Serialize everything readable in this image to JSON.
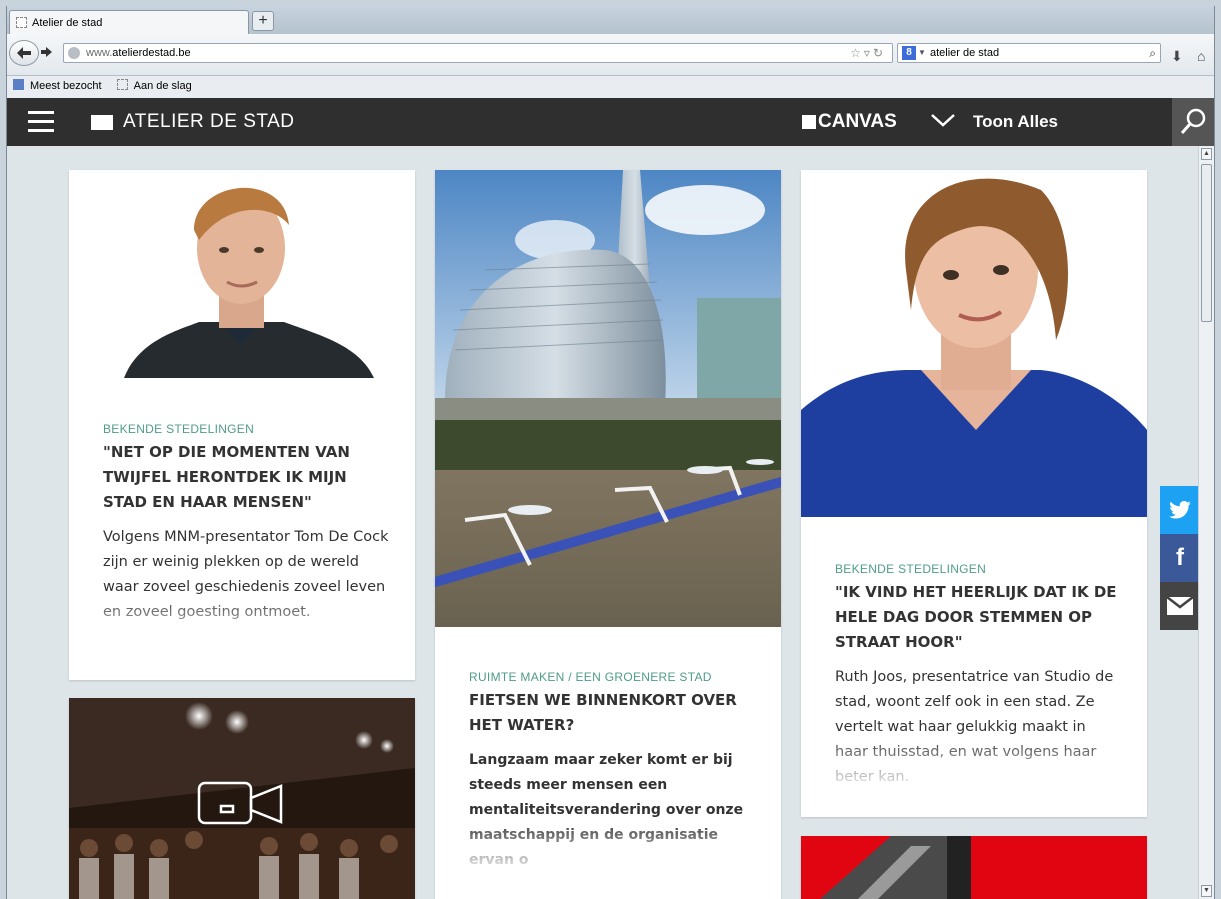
{
  "browser": {
    "tab_title": "Atelier de stad",
    "new_tab": "+",
    "url_prefix": "www.",
    "url_domain": "atelierdestad.be",
    "search_engine_badge": "8",
    "search_value": "atelier de stad",
    "bookmarks": [
      "Meest bezocht",
      "Aan de slag"
    ]
  },
  "site": {
    "brand": "ATELIER DE STAD",
    "canvas": "CANVAS",
    "toon_alles": "Toon Alles"
  },
  "cards": [
    {
      "category": "BEKENDE STEDELINGEN",
      "title": "\"NET OP DIE MOMENTEN VAN TWIJFEL HERONTDEK IK MIJN STAD EN HAAR MENSEN\"",
      "teaser": "Volgens MNM-presentator Tom De Cock zijn er weinig plekken op de wereld waar zoveel geschiedenis zoveel leven en zoveel goesting ontmoet."
    },
    {
      "category": "RUIMTE MAKEN / EEN GROENERE STAD",
      "title": "FIETSEN WE BINNENKORT OVER HET WATER?",
      "teaser": "Langzaam maar zeker komt er bij steeds meer mensen een mentaliteitsverandering over onze maatschappij en de organisatie ervan o"
    },
    {
      "category": "BEKENDE STEDELINGEN",
      "title": "\"IK VIND HET HEERLIJK DAT IK DE HELE DAG DOOR STEMMEN OP STRAAT HOOR\"",
      "teaser": "Ruth Joos, presentatrice van Studio de stad, woont zelf ook in een stad. Ze vertelt wat haar gelukkig maakt in haar thuisstad, en wat volgens haar beter kan."
    }
  ],
  "share": {
    "twitter": "twitter-icon",
    "facebook": "f",
    "mail": "mail-icon"
  },
  "colors": {
    "category": "#4f9c8a",
    "header": "#2f2f2f",
    "twitter": "#1da1f2",
    "facebook": "#3b5998",
    "mail": "#444444"
  }
}
